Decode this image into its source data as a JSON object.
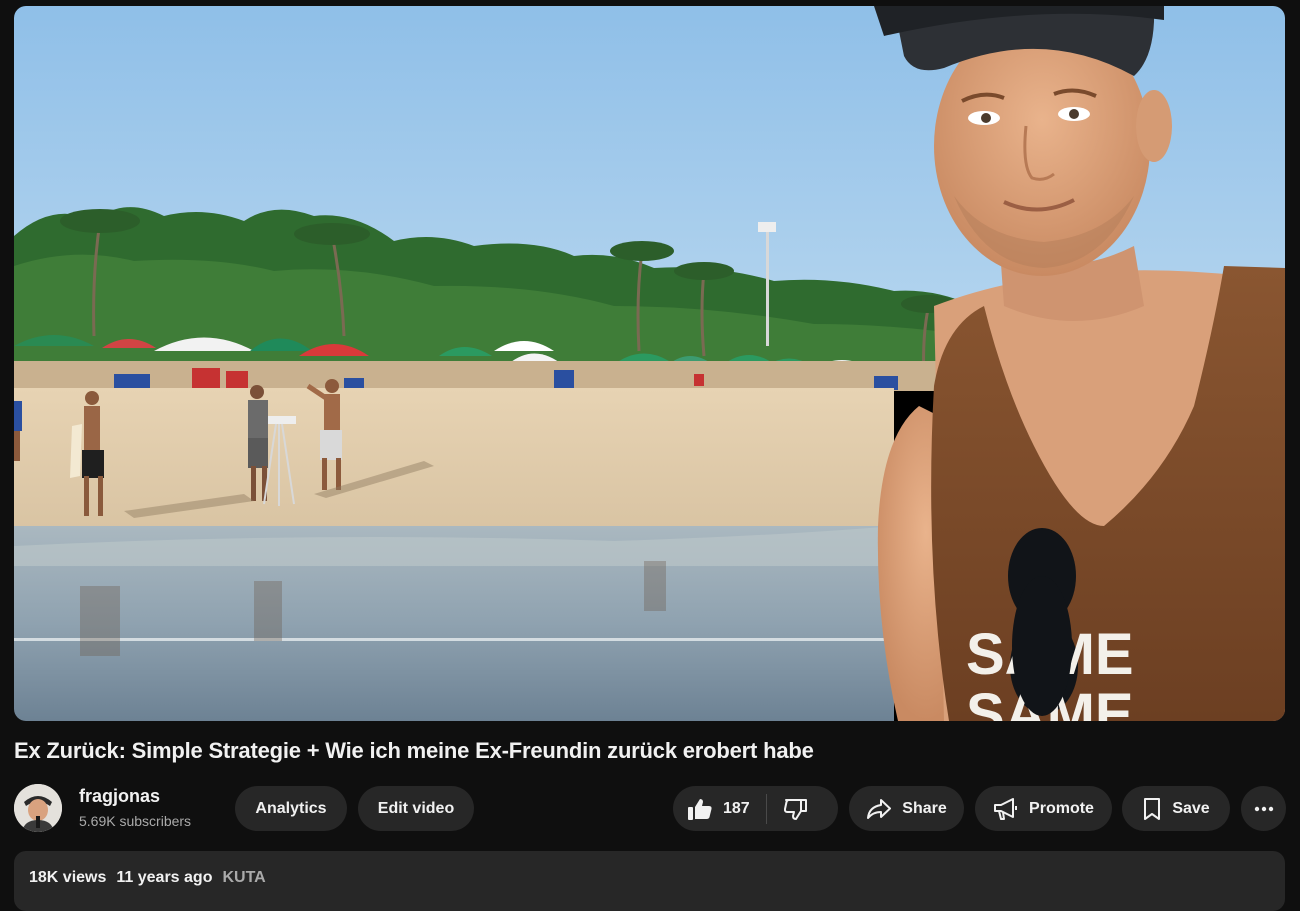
{
  "video": {
    "title": "Ex Zurück: Simple Strategie + Wie ich meine Ex-Freundin zurück erobert habe",
    "shirt_text_line1": "SAME",
    "shirt_text_line2": "SAME"
  },
  "channel": {
    "name": "fragjonas",
    "subscribers": "5.69K subscribers",
    "avatar_icon": "person-avatar-icon"
  },
  "actions": {
    "analytics_label": "Analytics",
    "edit_label": "Edit video",
    "like_count": "187",
    "share_label": "Share",
    "promote_label": "Promote",
    "save_label": "Save",
    "icons": [
      "thumbs-up-icon",
      "thumbs-down-icon",
      "share-arrow-icon",
      "megaphone-icon",
      "bookmark-icon",
      "more-dots-icon"
    ]
  },
  "description": {
    "views": "18K views",
    "age": "11 years ago",
    "location": "KUTA"
  },
  "colors": {
    "background": "#0f0f0f",
    "pill": "#272727",
    "secondary_text": "#aaaaaa"
  }
}
